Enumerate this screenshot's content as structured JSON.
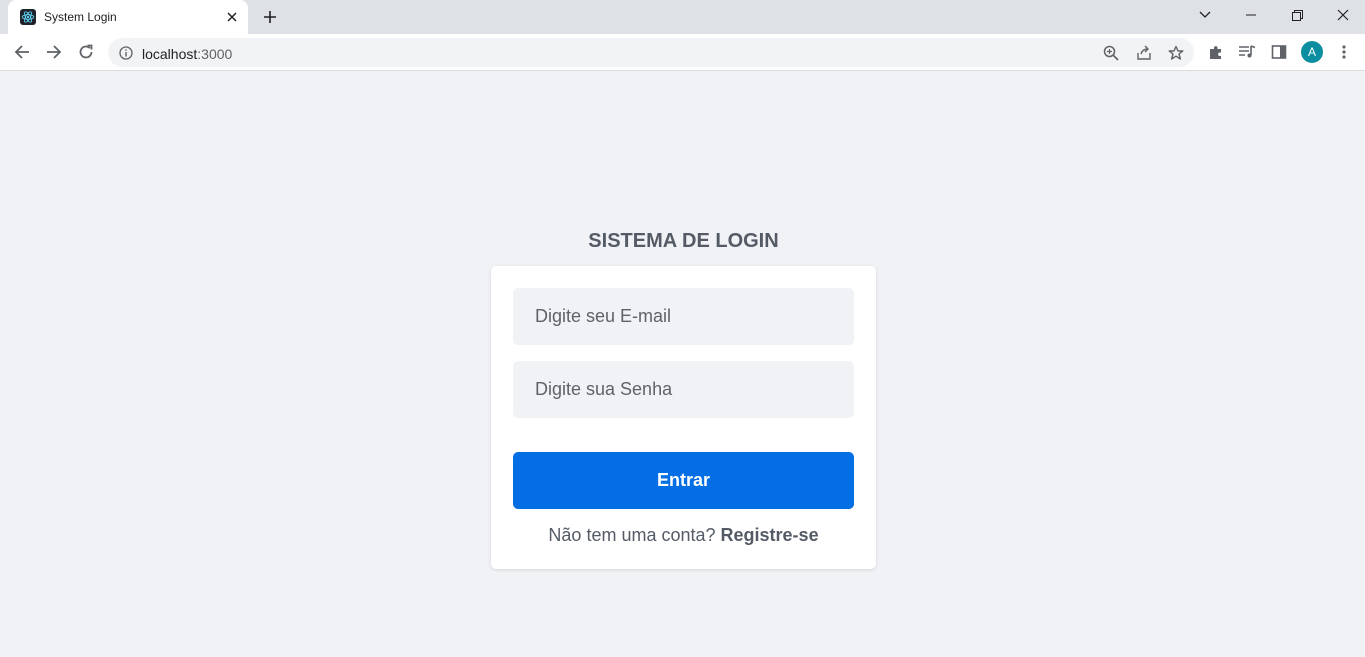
{
  "browser": {
    "tab": {
      "title": "System Login"
    },
    "address_bar": {
      "host": "localhost",
      "port": ":3000"
    },
    "profile_initial": "A"
  },
  "login": {
    "title": "SISTEMA DE LOGIN",
    "email_placeholder": "Digite seu E-mail",
    "password_placeholder": "Digite sua Senha",
    "submit_label": "Entrar",
    "signup_prompt": "Não tem uma conta?",
    "signup_link": "Registre-se"
  },
  "colors": {
    "accent": "#046ee5",
    "page_background": "#f0f2f5",
    "card_background": "#ffffff",
    "text": "#555b66",
    "avatar": "#0a8ea0"
  },
  "icons": [
    "react-icon",
    "close-icon",
    "plus-icon",
    "chevron-down-icon",
    "minimize-icon",
    "restore-icon",
    "back-arrow-icon",
    "forward-arrow-icon",
    "reload-icon",
    "info-icon",
    "zoom-icon",
    "share-icon",
    "star-icon",
    "puzzle-icon",
    "media-icon",
    "side-panel-icon",
    "kebab-menu-icon"
  ]
}
